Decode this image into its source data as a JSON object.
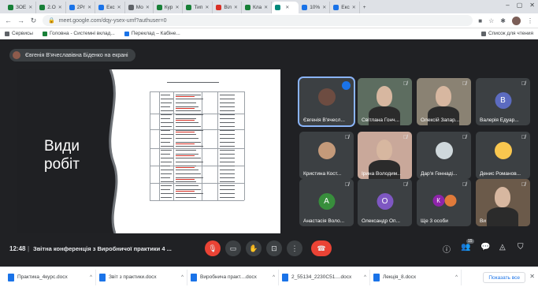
{
  "browser": {
    "tabs": [
      {
        "label": "ЗОЕ",
        "color": "#188038"
      },
      {
        "label": "2.О",
        "color": "#188038"
      },
      {
        "label": "2Рг",
        "color": "#1a73e8"
      },
      {
        "label": "Екс",
        "color": "#1a73e8"
      },
      {
        "label": "Мо",
        "color": "#5f6368"
      },
      {
        "label": "Кур",
        "color": "#188038"
      },
      {
        "label": "Тип",
        "color": "#188038"
      },
      {
        "label": "Віл",
        "color": "#d93025"
      },
      {
        "label": "Кла",
        "color": "#188038"
      },
      {
        "label": "",
        "color": "#00897b"
      },
      {
        "label": "10%",
        "color": "#1a73e8"
      },
      {
        "label": "Екс",
        "color": "#1a73e8"
      }
    ],
    "address": "meet.google.com/dqy-ysex-umf?authuser=0",
    "bookmarks": {
      "apps": "Сервисы",
      "item1": "Головна - Системні вклад...",
      "item2": "Переклад – Кабіне...",
      "other": "Список для чтения"
    }
  },
  "meet": {
    "presenting_label": "Євгенія В'ячеславівна Біденко на екрані",
    "slide": {
      "title_line1": "Види",
      "title_line2": "робіт"
    },
    "participants": [
      {
        "name": "Євгенія В'ячесл...",
        "kind": "photo",
        "color": "#6d4c41",
        "speaking": true
      },
      {
        "name": "Світлана Гонч...",
        "kind": "video",
        "color": "#5d6d60"
      },
      {
        "name": "Олексій Запар...",
        "kind": "video",
        "color": "#8a8273"
      },
      {
        "name": "Валерія Едуар...",
        "kind": "letter",
        "letter": "В",
        "color": "#5c6bc0"
      },
      {
        "name": "Кристина Кост...",
        "kind": "photo",
        "color": "#c49a7a"
      },
      {
        "name": "Ірина Володим...",
        "kind": "video",
        "color": "#c9a89a"
      },
      {
        "name": "Дар'я Геннаді...",
        "kind": "photo",
        "color": "#cfd8dc"
      },
      {
        "name": "Денис Романов...",
        "kind": "photo",
        "color": "#f9c74f"
      },
      {
        "name": "Анастасія Воло...",
        "kind": "letter",
        "letter": "А",
        "color": "#388e3c"
      },
      {
        "name": "Олександр Оп...",
        "kind": "letter",
        "letter": "О",
        "color": "#7e57c2"
      },
      {
        "name": "Ще 3 особи",
        "kind": "group",
        "letter": "К",
        "color": "#8e24aa"
      },
      {
        "name": "Ви",
        "kind": "video",
        "color": "#6b5a4a"
      }
    ],
    "time": "12:48",
    "meeting_name": "Звітна конференція з Виробничої практики 4 ...",
    "people_count": "15"
  },
  "downloads": {
    "items": [
      "Практика_4курс.docx",
      "Звіт з практики.docx",
      "Виробнича практ....docx",
      "2_55134_2230С51....docx",
      "Лекція_8.docx"
    ],
    "show_all": "Показать все"
  },
  "colors": {
    "meet_bg": "#202124",
    "tile_bg": "#3c4043",
    "end_call": "#ea4335",
    "speaker_outline": "#8ab4f8"
  }
}
